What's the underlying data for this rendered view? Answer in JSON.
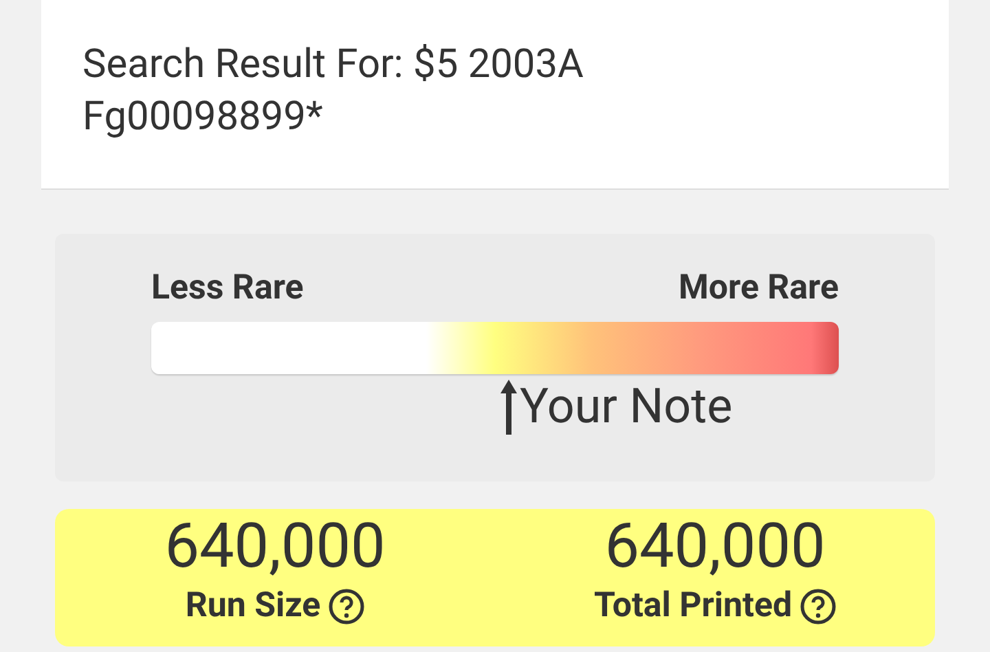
{
  "header": {
    "title": "Search Result For: $5 2003A Fg00098899*"
  },
  "rarity": {
    "low_label": "Less Rare",
    "high_label": "More Rare",
    "marker_label": "Your Note",
    "level": 0.52
  },
  "stats": [
    {
      "value": "640,000",
      "label": "Run Size"
    },
    {
      "value": "640,000",
      "label": "Total Printed"
    }
  ]
}
